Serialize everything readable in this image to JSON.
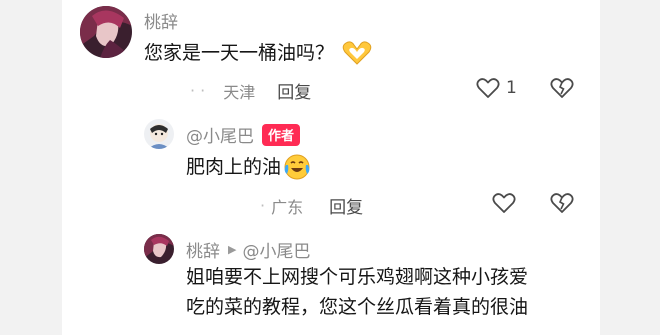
{
  "comments": [
    {
      "username": "桃辞",
      "text": "您家是一天一桶油吗？",
      "emoji": "heart-hands",
      "location_prefix": "· ·",
      "location": "天津",
      "reply_label": "回复",
      "like_count": "1"
    },
    {
      "username": "@小尾巴",
      "author_badge": "作者",
      "text": "肥肉上的油",
      "emoji": "crying-laughing",
      "location_prefix": "·",
      "location": "广东",
      "reply_label": "回复"
    },
    {
      "username": "桃辞",
      "reply_arrow": "▶",
      "reply_to": "@小尾巴",
      "text_lines": [
        "姐咱要不上网搜个可乐鸡翅啊这种小孩爱",
        "吃的菜的教程，您这个丝瓜看着真的很油"
      ]
    }
  ],
  "colors": {
    "background": "#f2f2f2",
    "badge": "#ff2b54",
    "meta_text": "#8a8a8a",
    "body_text": "#161616"
  }
}
